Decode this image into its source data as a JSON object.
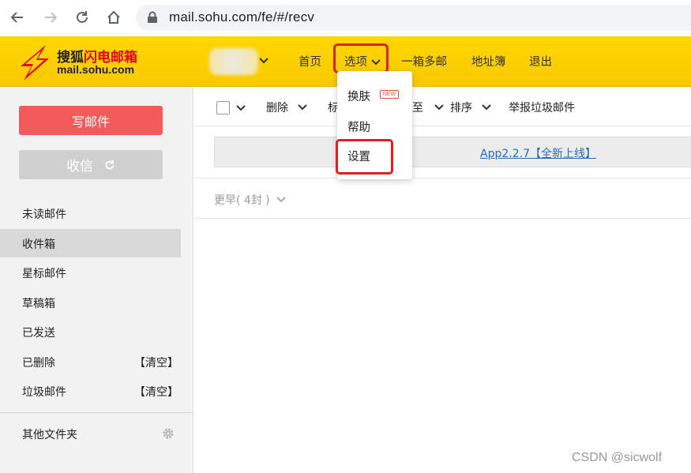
{
  "browser": {
    "url": "mail.sohu.com/fe/#/recv",
    "icons": [
      "back-icon",
      "forward-icon",
      "reload-icon",
      "home-icon",
      "lock-icon"
    ]
  },
  "header": {
    "logo_brand_prefix": "搜狐",
    "logo_brand_suffix": "闪电邮箱",
    "logo_url": "mail.sohu.com",
    "nav": {
      "home": "首页",
      "options": "选项",
      "multi_account": "一箱多邮",
      "address_book": "地址簿",
      "logout": "退出"
    }
  },
  "options_menu": {
    "items": [
      "换肤",
      "帮助",
      "设置"
    ],
    "new_badge": "NEW"
  },
  "sidebar": {
    "compose": "写邮件",
    "receive": "收信",
    "folders": [
      {
        "label": "未读邮件",
        "action": ""
      },
      {
        "label": "收件箱",
        "action": ""
      },
      {
        "label": "星标邮件",
        "action": ""
      },
      {
        "label": "草稿箱",
        "action": ""
      },
      {
        "label": "已发送",
        "action": ""
      },
      {
        "label": "已删除",
        "action": "【清空】"
      },
      {
        "label": "垃圾邮件",
        "action": "【清空】"
      }
    ],
    "other_folders": "其他文件夹"
  },
  "toolbar": {
    "delete": "删除",
    "mark_partial": "标",
    "move_partial": "至",
    "sort": "排序",
    "report_spam": "举报垃圾邮件"
  },
  "banner": {
    "link": "App2.2.7【全新上线】"
  },
  "list": {
    "earlier_group": "更早( 4封 )"
  },
  "watermark": "CSDN @sicwolf",
  "colors": {
    "header_yellow": "#f9c900",
    "compose_red": "#f25b59",
    "highlight_red": "#e02020",
    "link_blue": "#2a6ab8"
  }
}
